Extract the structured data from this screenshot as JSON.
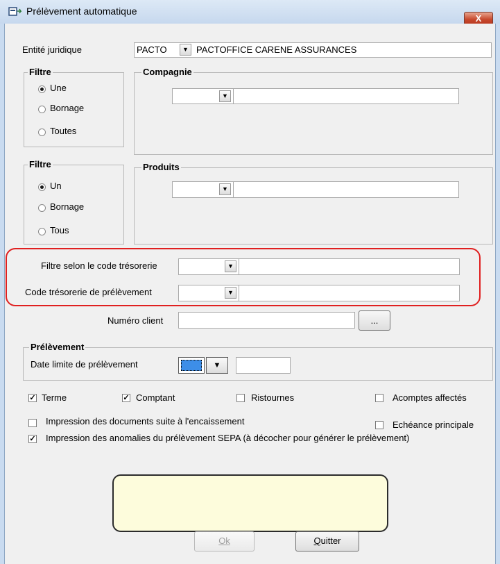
{
  "window": {
    "title": "Prélèvement automatique",
    "close_label": "X"
  },
  "entite": {
    "label": "Entité juridique",
    "code": "PACTO",
    "name": "PACTOFFICE CARENE ASSURANCES"
  },
  "filtre1": {
    "title": "Filtre",
    "options": [
      "Une",
      "Bornage",
      "Toutes"
    ],
    "selected": "Une"
  },
  "compagnie": {
    "title": "Compagnie",
    "value": "",
    "name": ""
  },
  "filtre2": {
    "title": "Filtre",
    "options": [
      "Un",
      "Bornage",
      "Tous"
    ],
    "selected": "Un"
  },
  "produits": {
    "title": "Produits",
    "value": "",
    "name": ""
  },
  "tresorerie": {
    "filtre_label": "Filtre selon le code trésorerie",
    "code_label": "Code trésorerie de prélèvement"
  },
  "numero_client": {
    "label": "Numéro client",
    "value": "",
    "browse_label": "..."
  },
  "prelevement": {
    "title": "Prélèvement",
    "date_label": "Date  limite de prélèvement",
    "date_value": ""
  },
  "checkboxes": {
    "terme": {
      "label": "Terme",
      "checked": true
    },
    "comptant": {
      "label": "Comptant",
      "checked": true
    },
    "ristournes": {
      "label": "Ristournes",
      "checked": false
    },
    "acomptes": {
      "label": "Acomptes affectés",
      "checked": false
    },
    "impression_docs": {
      "label": "Impression des documents suite à l'encaissement",
      "checked": false
    },
    "echeance": {
      "label": "Echéance principale",
      "checked": false
    },
    "impression_anomalies": {
      "label": "Impression des anomalies du prélèvement SEPA (à décocher pour générer le prélèvement)",
      "checked": true
    }
  },
  "buttons": {
    "ok": "Ok",
    "quitter": "Quitter"
  },
  "colors": {
    "highlight": "#e02020",
    "note_bg": "#fdfcdc",
    "date_picker": "#3d8ee8"
  }
}
